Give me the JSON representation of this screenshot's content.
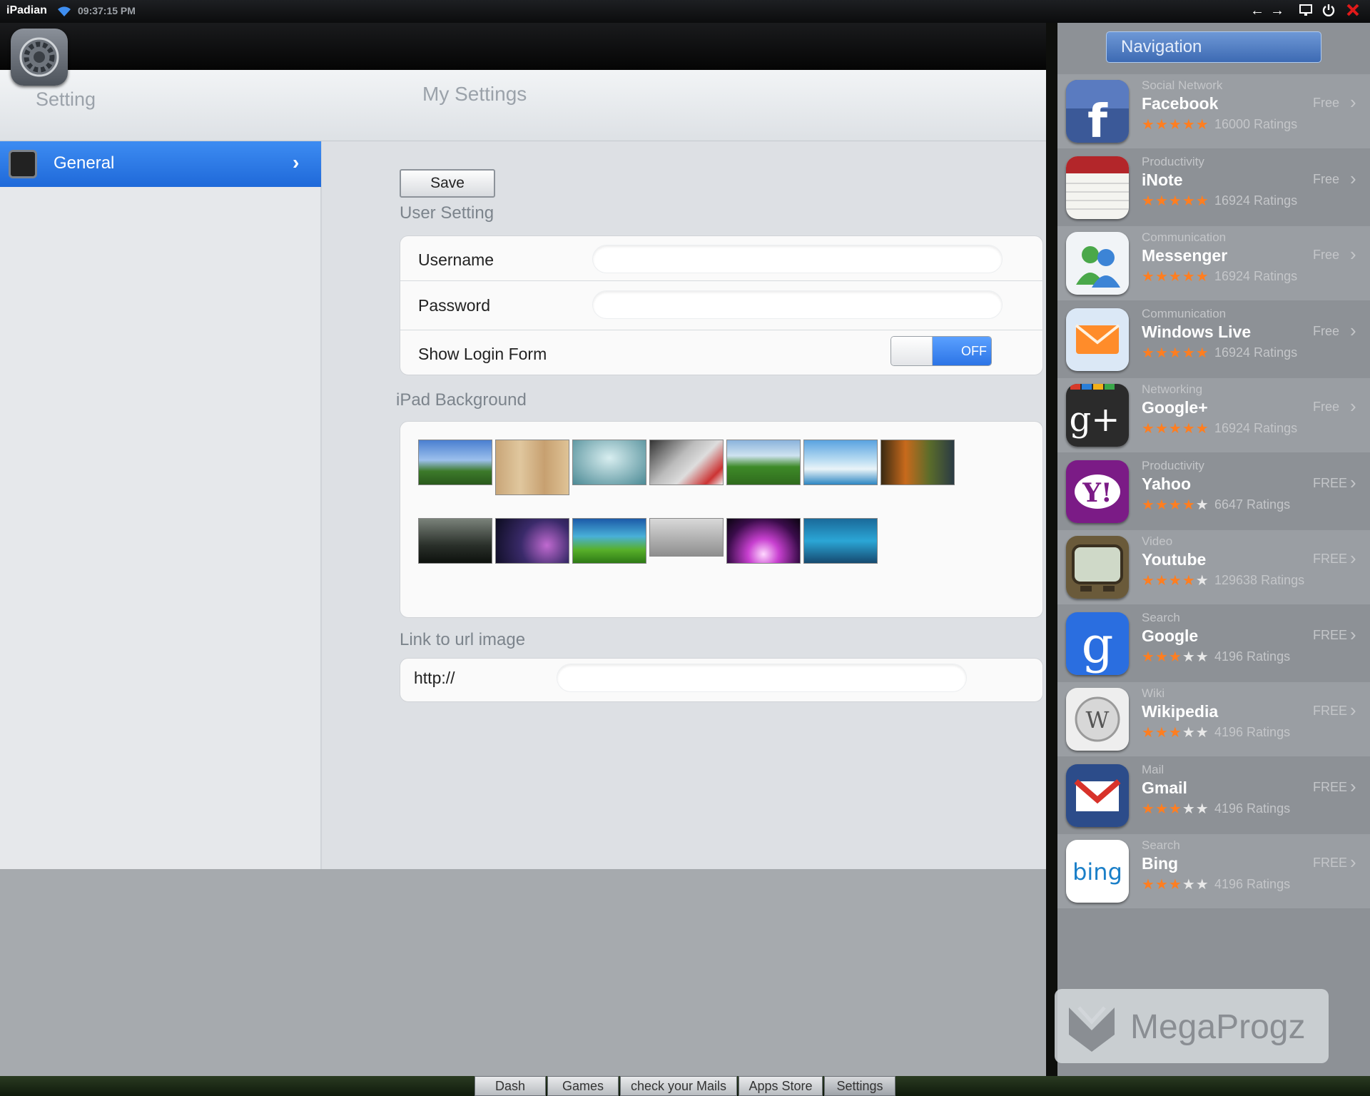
{
  "status_bar": {
    "brand": "iPadian",
    "time": "09:37:15 PM",
    "controls": [
      "back-arrow",
      "forward-arrow",
      "monitor",
      "power",
      "close"
    ]
  },
  "settings": {
    "sidebar_title": "Setting",
    "page_title": "My Settings",
    "menu": [
      {
        "label": "General",
        "selected": true
      }
    ],
    "save_label": "Save",
    "user_setting_label": "User Setting",
    "username_label": "Username",
    "username_value": "",
    "password_label": "Password",
    "password_value": "",
    "show_login_label": "Show Login Form",
    "show_login_state": "OFF",
    "background_label": "iPad Background",
    "link_label": "Link to url image",
    "link_value": "http://"
  },
  "navigation": {
    "title": "Navigation",
    "apps": [
      {
        "category": "Social Network",
        "name": "Facebook",
        "rating": 5,
        "ratings": "16000 Ratings",
        "price": "Free"
      },
      {
        "category": "Productivity",
        "name": "iNote",
        "rating": 5,
        "ratings": "16924 Ratings",
        "price": "Free"
      },
      {
        "category": "Communication",
        "name": "Messenger",
        "rating": 5,
        "ratings": "16924 Ratings",
        "price": "Free"
      },
      {
        "category": "Communication",
        "name": "Windows Live",
        "rating": 5,
        "ratings": "16924 Ratings",
        "price": "Free"
      },
      {
        "category": "Networking",
        "name": "Google+",
        "rating": 5,
        "ratings": "16924 Ratings",
        "price": "Free"
      },
      {
        "category": "Productivity",
        "name": "Yahoo",
        "rating": 4,
        "ratings": "6647 Ratings",
        "price": "FREE"
      },
      {
        "category": "Video",
        "name": "Youtube",
        "rating": 4,
        "ratings": "129638 Ratings",
        "price": "FREE"
      },
      {
        "category": "Search",
        "name": "Google",
        "rating": 3,
        "ratings": "4196 Ratings",
        "price": "FREE"
      },
      {
        "category": "Wiki",
        "name": "Wikipedia",
        "rating": 3,
        "ratings": "4196 Ratings",
        "price": "FREE"
      },
      {
        "category": "Mail",
        "name": "Gmail",
        "rating": 3,
        "ratings": "4196 Ratings",
        "price": "FREE"
      },
      {
        "category": "Search",
        "name": "Bing",
        "rating": 3,
        "ratings": "4196 Ratings",
        "price": "FREE"
      }
    ]
  },
  "watermark": {
    "text": "MegaProgz"
  },
  "taskbar": {
    "buttons": [
      "Dash",
      "Games",
      "check your Mails",
      "Apps Store",
      "Settings"
    ],
    "active": "Settings"
  },
  "colors": {
    "accent_blue": "#2c74e6",
    "star_orange": "#ff7e20",
    "nav_panel": "#8d9196"
  }
}
